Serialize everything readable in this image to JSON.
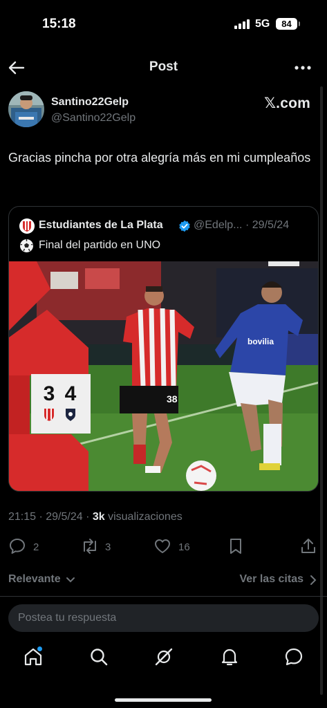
{
  "status": {
    "time": "15:18",
    "network": "5G",
    "battery": "84"
  },
  "topbar": {
    "title": "Post",
    "back_icon": "arrow-left-icon",
    "more_icon": "more-dots-icon"
  },
  "author": {
    "name": "Santino22Gelp",
    "handle": "@Santino22Gelp",
    "watermark": "𝕏.com"
  },
  "tweet": {
    "text": "Gracias pincha por otra alegría más en mi cumpleaños"
  },
  "quote": {
    "name": "Estudiantes de La Plata",
    "handle": "@Edelp... · 29/5/24",
    "text": "Final del partido en UNO",
    "score_home": "3",
    "score_away": "4",
    "player_number": "38",
    "sponsor": "bovilia"
  },
  "meta": {
    "time_date": "21:15 · 29/5/24 · ",
    "views_count": "3k",
    "views_label": " visualizaciones"
  },
  "actions": {
    "replies": "2",
    "reposts": "3",
    "likes": "16"
  },
  "sort": {
    "label": "Relevante",
    "quotes_link": "Ver las citas"
  },
  "reply": {
    "placeholder": "Postea tu respuesta"
  },
  "tabs": [
    "home-icon",
    "search-icon",
    "grok-icon",
    "notifications-icon",
    "messages-icon"
  ],
  "colors": {
    "accent": "#1d9bf0",
    "background": "#000000",
    "muted": "#71767b"
  }
}
